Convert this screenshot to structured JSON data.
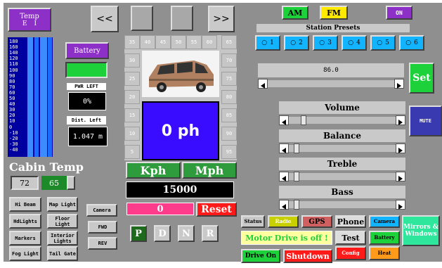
{
  "temp": {
    "title": "Temp",
    "units": [
      "E",
      "I"
    ]
  },
  "nav": {
    "prev_label": "<<",
    "next_label": ">>"
  },
  "thermo": {
    "scale": [
      "180",
      "160",
      "140",
      "120",
      "110",
      "100",
      "90",
      "80",
      "70",
      "60",
      "50",
      "40",
      "30",
      "20",
      "10",
      "0",
      "-10",
      "-20",
      "-30",
      "-40"
    ]
  },
  "battery": {
    "label": "Battery",
    "pwr_left_label": "PWR LEFT",
    "pwr_left_value": "0%",
    "dist_left_label": "Dist. Left",
    "dist_left_value": "1.047 m"
  },
  "cabin": {
    "label": "Cabin Temp",
    "setpoint": "72",
    "actual": "65"
  },
  "speedo": {
    "left_ticks": [
      "35",
      "30",
      "25",
      "20",
      "15",
      "10",
      "5"
    ],
    "top_ticks": [
      "40",
      "45",
      "50",
      "55",
      "60"
    ],
    "right_ticks": [
      "65",
      "70",
      "75",
      "80",
      "85",
      "90",
      "95"
    ],
    "display": "0 ph",
    "kph_label": "Kph",
    "mph_label": "Mph",
    "odometer": "15000",
    "trip": "0",
    "reset_label": "Reset"
  },
  "lights": {
    "hi_beam": "Hi Beam",
    "map_light": "Map Light",
    "hd_lights": "HdLights",
    "floor_light": "Floor Light",
    "markers": "Markers",
    "interior_lights": "Interior Lights",
    "fog_light": "Fog Light",
    "tail_gate": "Tail Gate"
  },
  "camera_buttons": {
    "camera": "Camera",
    "fwd": "FWD",
    "rev": "REV"
  },
  "gears": [
    "P",
    "D",
    "N",
    "R"
  ],
  "radio": {
    "am_label": "AM",
    "fm_label": "FM",
    "on_label": "ON",
    "presets_label": "Station Presets",
    "presets": [
      "1",
      "2",
      "3",
      "4",
      "5",
      "6"
    ],
    "frequency": "86.0",
    "set_label": "Set",
    "mute_label": "MUTE"
  },
  "sliders": [
    {
      "label": "Volume",
      "value": 0.12
    },
    {
      "label": "Balance",
      "value": 0.05
    },
    {
      "label": "Treble",
      "value": 0.05
    },
    {
      "label": "Bass",
      "value": 0.05
    }
  ],
  "menu": {
    "status": "Status",
    "radio": "Radio",
    "gps": "GPS",
    "phone": "Phone",
    "camera": "Camera",
    "mirrors": "Mirrors & Windows",
    "test": "Test",
    "battery": "Battery",
    "config": "Config",
    "heat": "Heat",
    "motor_status": "Motor Drive is off !",
    "drive_on": "Drive On",
    "shutdown": "Shutdown"
  },
  "colors": {
    "panel": "#909090",
    "purple": "#8d30c8",
    "blue": "#3a0cff",
    "green": "#1dd13a",
    "red": "#ff1a1a",
    "pink": "#ff3c8c",
    "cyan": "#12b4ff",
    "yellow": "#ffea00"
  }
}
